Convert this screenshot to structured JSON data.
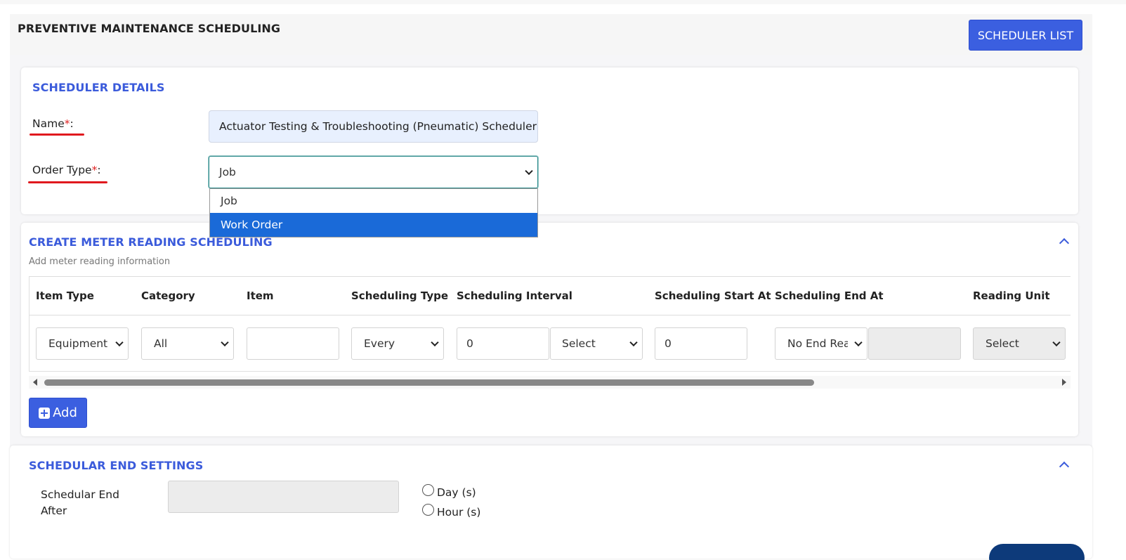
{
  "page": {
    "title": "PREVENTIVE MAINTENANCE SCHEDULING",
    "scheduler_list_label": "SCHEDULER LIST"
  },
  "scheduler_details": {
    "title": "SCHEDULER DETAILS",
    "name_label": "Name",
    "required_mark": "*",
    "colon": ":",
    "name_value": "Actuator Testing & Troubleshooting (Pneumatic) Scheduler",
    "order_type_label": "Order Type",
    "order_type_value": "Job",
    "order_type_options": [
      "Job",
      "Work Order"
    ],
    "highlighted_option": "Work Order"
  },
  "meter_reading": {
    "title": "CREATE METER READING SCHEDULING",
    "subtitle": "Add meter reading information",
    "columns": [
      "Item Type",
      "Category",
      "Item",
      "Scheduling Type",
      "Scheduling Interval",
      "Scheduling Start At",
      "Scheduling End At",
      "Reading Unit"
    ],
    "row": {
      "item_type": "Equipment",
      "category": "All",
      "item": "",
      "scheduling_type": "Every",
      "interval_value": "0",
      "interval_unit": "Select",
      "start_at": "0",
      "end_at": "No End Reading",
      "end_at_value": "",
      "reading_unit": "Select"
    },
    "add_label": "Add"
  },
  "end_settings": {
    "title": "SCHEDULAR END SETTINGS",
    "label": "Schedular End After",
    "value": "",
    "options": [
      "Day (s)",
      "Hour (s)"
    ]
  },
  "colors": {
    "accent": "#3b5fe0",
    "section_title": "#3b5bdb",
    "required": "#e02424",
    "dropdown_highlight": "#1a6ad8"
  }
}
